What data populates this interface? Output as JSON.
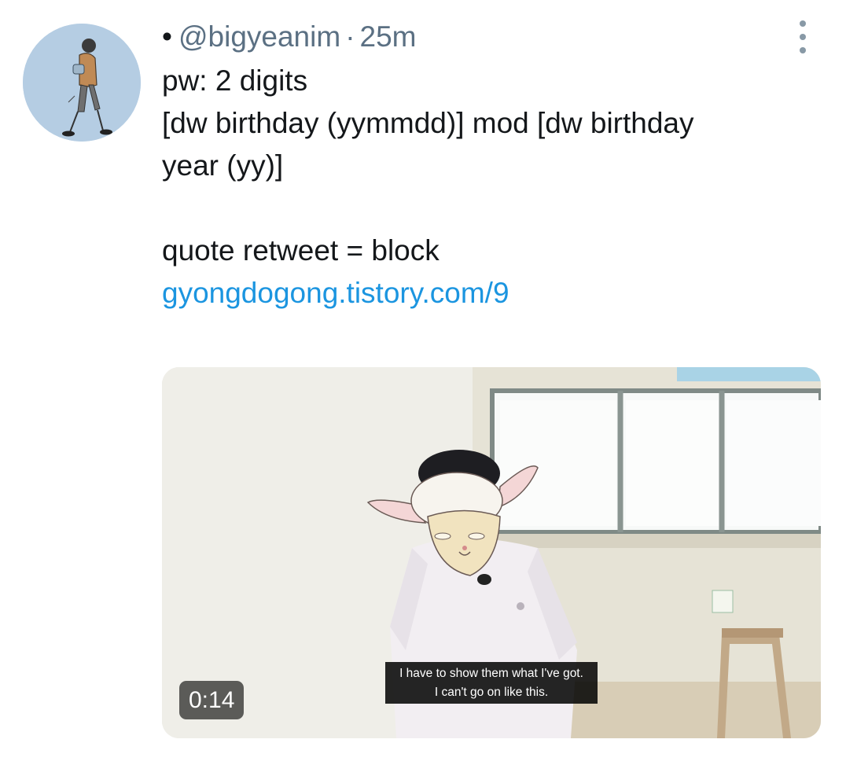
{
  "tweet": {
    "bullet": "•",
    "handle": "@bigyeanim",
    "separator": "·",
    "time": "25m",
    "body": "pw: 2 digits\n[dw birthday (yymmdd)] mod [dw birthday\nyear (yy)]\n\nquote retweet = block\n",
    "link": "gyongdogong.tistory.com/9",
    "more_icon": "more-vertical-icon"
  },
  "video": {
    "duration": "0:14",
    "subtitle_line1": "I have to show them what I've got.",
    "subtitle_line2": "I can't go on like this."
  },
  "colors": {
    "link": "#1b95e0",
    "meta": "#5b7083",
    "text": "#14171a",
    "avatar_bg": "#b5cde3"
  }
}
